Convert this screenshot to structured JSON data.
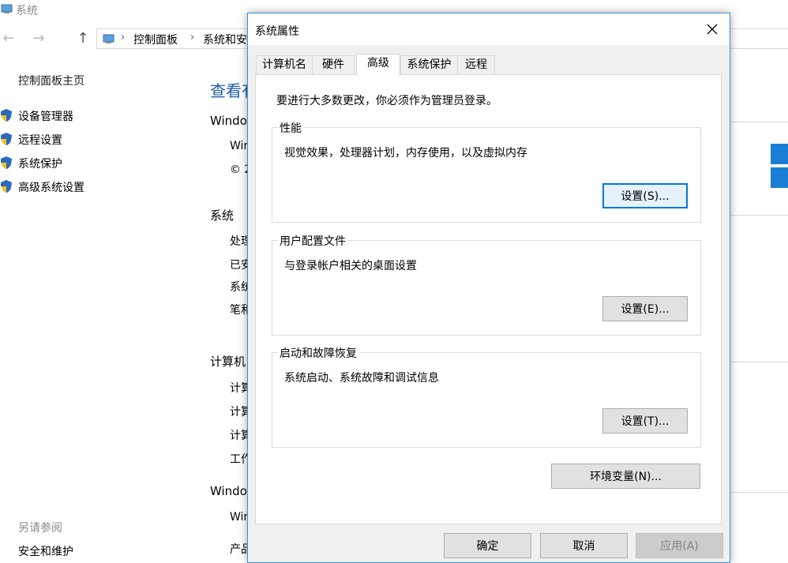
{
  "background_window": {
    "title": "系统",
    "nav": {
      "back_icon": "arrow-left-icon",
      "forward_icon": "arrow-right-icon",
      "up_icon": "arrow-up-icon"
    },
    "breadcrumbs": [
      "控制面板",
      "系统和安"
    ],
    "sidebar": {
      "home_link": "控制面板主页",
      "items": [
        {
          "label": "设备管理器",
          "icon": "shield-icon"
        },
        {
          "label": "远程设置",
          "icon": "shield-icon"
        },
        {
          "label": "系统保护",
          "icon": "shield-icon"
        },
        {
          "label": "高级系统设置",
          "icon": "shield-icon"
        }
      ],
      "see_also_heading": "另请参阅",
      "see_also_link": "安全和维护"
    },
    "main": {
      "heading": "查看有",
      "sections": [
        {
          "label": "Windo",
          "rows": [
            "Wir",
            "© 2"
          ]
        },
        {
          "label": "系统",
          "rows": [
            "处理",
            "已安",
            "系统",
            "笔和"
          ]
        },
        {
          "label": "计算机",
          "rows": [
            "计算",
            "计算",
            "计算",
            "工作"
          ]
        },
        {
          "label": "Windo",
          "rows": [
            "Wir",
            "产品"
          ]
        }
      ]
    }
  },
  "dialog": {
    "title": "系统属性",
    "close_icon": "close-icon",
    "tabs": [
      {
        "label": "计算机名",
        "active": false
      },
      {
        "label": "硬件",
        "active": false
      },
      {
        "label": "高级",
        "active": true
      },
      {
        "label": "系统保护",
        "active": false
      },
      {
        "label": "远程",
        "active": false
      }
    ],
    "admin_note": "要进行大多数更改，你必须作为管理员登录。",
    "groups": [
      {
        "title": "性能",
        "description": "视觉效果，处理器计划，内存使用，以及虚拟内存",
        "button": "设置(S)..."
      },
      {
        "title": "用户配置文件",
        "description": "与登录帐户相关的桌面设置",
        "button": "设置(E)..."
      },
      {
        "title": "启动和故障恢复",
        "description": "系统启动、系统故障和调试信息",
        "button": "设置(T)..."
      }
    ],
    "env_button": "环境变量(N)...",
    "footer": {
      "ok": "确定",
      "cancel": "取消",
      "apply": "应用(A)"
    }
  },
  "colors": {
    "accent": "#0078d7",
    "dialog_border": "#3a8fd8",
    "link": "#1e5ea8",
    "windows_logo": "#1a7fd4"
  }
}
